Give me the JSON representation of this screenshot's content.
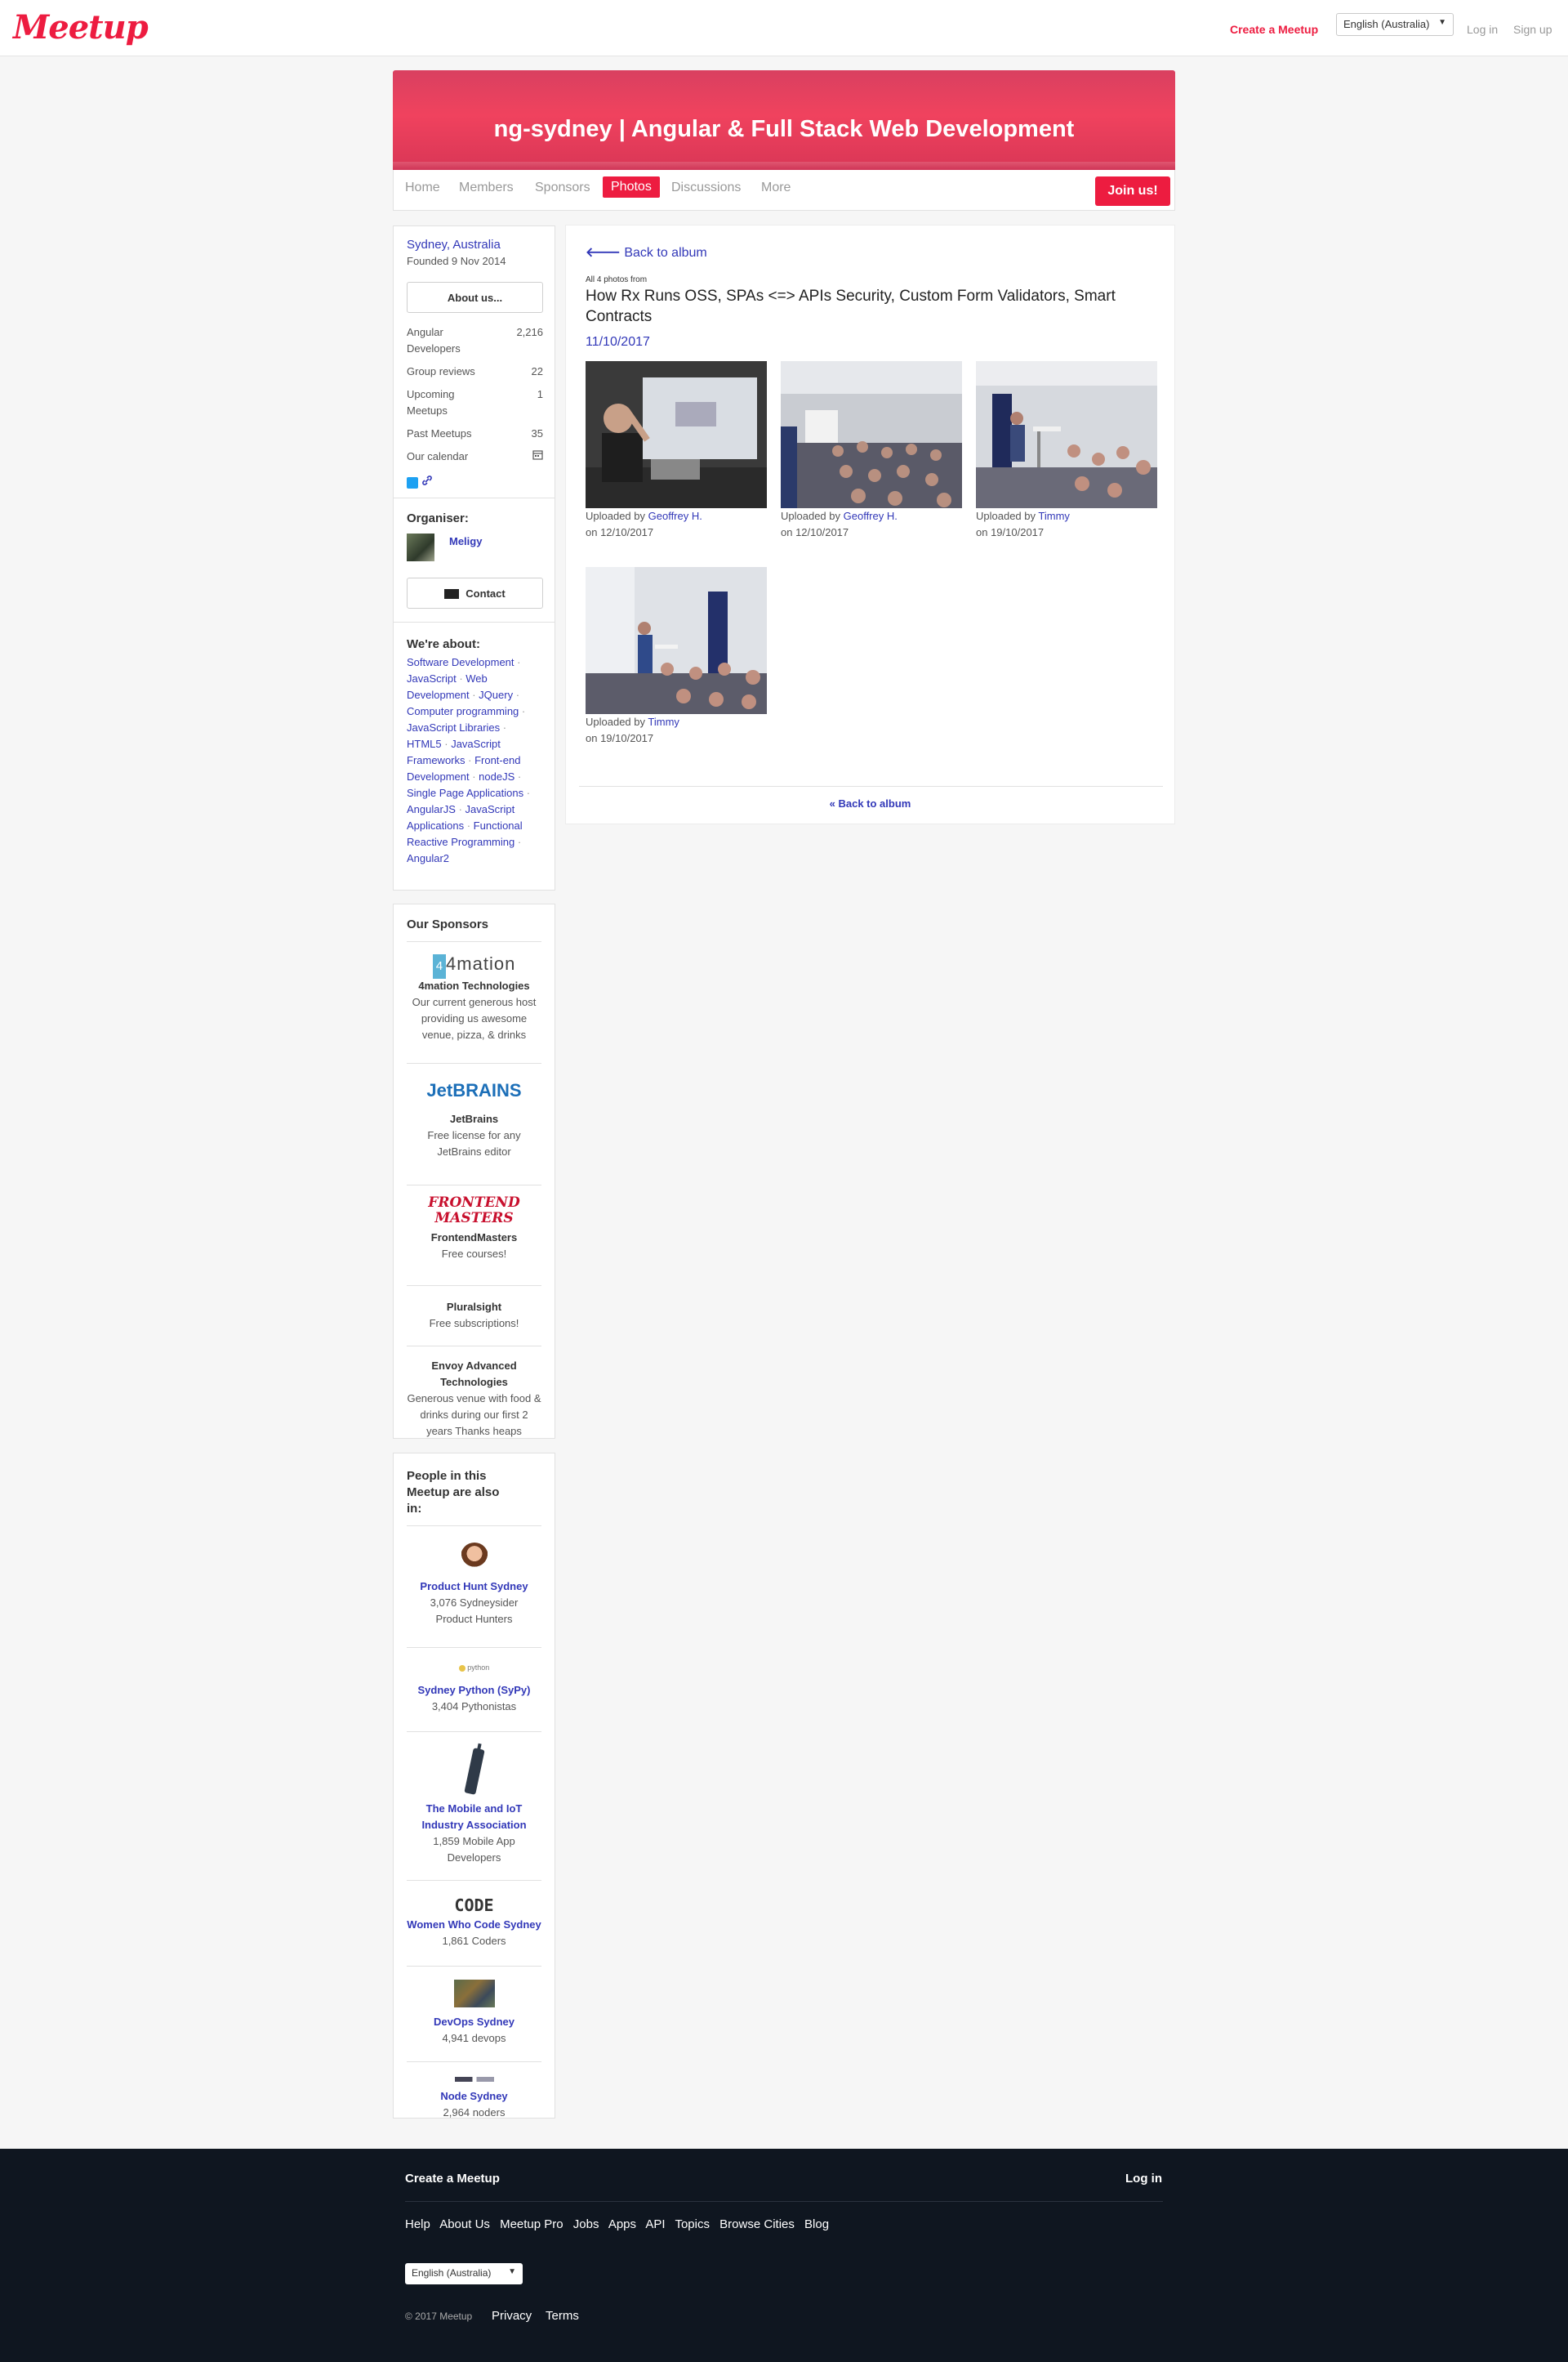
{
  "header": {
    "logo": "Meetup",
    "create": "Create a Meetup",
    "language": "English (Australia)",
    "login": "Log in",
    "signup": "Sign up"
  },
  "group": {
    "name": "ng-sydney | Angular & Full Stack Web Development",
    "tabs": [
      "Home",
      "Members",
      "Sponsors",
      "Photos",
      "Discussions",
      "More"
    ],
    "active_tab": "Photos",
    "join": "Join us!"
  },
  "sidebar": {
    "location": "Sydney, Australia",
    "founded": "Founded 9 Nov 2014",
    "about_button": "About us...",
    "stats": [
      {
        "label": "Angular Developers",
        "value": "2,216"
      },
      {
        "label": "Group reviews",
        "value": "22"
      },
      {
        "label": "Upcoming Meetups",
        "value": "1"
      },
      {
        "label": "Past Meetups",
        "value": "35"
      },
      {
        "label": "Our calendar",
        "value": ""
      }
    ],
    "organiser_heading": "Organiser:",
    "organiser_name": "Meligy",
    "contact_button": "Contact",
    "about_heading": "We're about:",
    "topics": [
      "Software Development",
      "JavaScript",
      "Web Development",
      "JQuery",
      "Computer programming",
      "JavaScript Libraries",
      "HTML5",
      "JavaScript Frameworks",
      "Front-end Development",
      "nodeJS",
      "Single Page Applications",
      "AngularJS",
      "JavaScript Applications",
      "Functional Reactive Programming",
      "Angular2"
    ]
  },
  "sponsors": {
    "heading": "Our Sponsors",
    "items": [
      {
        "name": "4mation Technologies",
        "desc": "Our current generous host providing us awesome venue, pizza, & drinks",
        "logo": "4mation"
      },
      {
        "name": "JetBrains",
        "desc": "Free license for any JetBrains editor",
        "logo": "JetBRAINS"
      },
      {
        "name": "FrontendMasters",
        "desc": "Free courses!",
        "logo": "FRONTEND MASTERS"
      },
      {
        "name": "Pluralsight",
        "desc": "Free subscriptions!",
        "logo": ""
      },
      {
        "name": "Envoy Advanced Technologies",
        "desc": "Generous venue with food & drinks during our first 2 years Thanks heaps",
        "logo": ""
      }
    ]
  },
  "also_in": {
    "heading": "People in this Meetup are also in:",
    "groups": [
      {
        "name": "Product Hunt Sydney",
        "desc": "3,076 Sydneysider Product Hunters"
      },
      {
        "name": "Sydney Python (SyPy)",
        "desc": "3,404 Pythonistas"
      },
      {
        "name": "The Mobile and IoT Industry Association",
        "desc": "1,859 Mobile App Developers"
      },
      {
        "name": "Women Who Code Sydney",
        "desc": "1,861 Coders"
      },
      {
        "name": "DevOps Sydney",
        "desc": "4,941 devops"
      },
      {
        "name": "Node Sydney",
        "desc": "2,964 noders"
      }
    ],
    "logo_texts": {
      "python": "python",
      "code": "CODE"
    }
  },
  "album": {
    "back": "Back to album",
    "all_photos": "All 4 photos from",
    "title": "How Rx Runs OSS, SPAs <=> APIs Security, Custom Form Validators, Smart Contracts",
    "date": "11/10/2017",
    "uploaded_by": "Uploaded by",
    "photos": [
      {
        "uploader": "Geoffrey H.",
        "date": "on 12/10/2017"
      },
      {
        "uploader": "Geoffrey H.",
        "date": "on 12/10/2017"
      },
      {
        "uploader": "Timmy",
        "date": "on 19/10/2017"
      },
      {
        "uploader": "Timmy",
        "date": "on 19/10/2017"
      }
    ],
    "back_bottom": "« Back to album"
  },
  "footer": {
    "create": "Create a Meetup",
    "login": "Log in",
    "links": [
      "Help",
      "About Us",
      "Meetup Pro",
      "Jobs",
      "Apps",
      "API",
      "Topics",
      "Browse Cities",
      "Blog"
    ],
    "language": "English (Australia)",
    "copyright": "© 2017 Meetup",
    "privacy": "Privacy",
    "terms": "Terms"
  }
}
